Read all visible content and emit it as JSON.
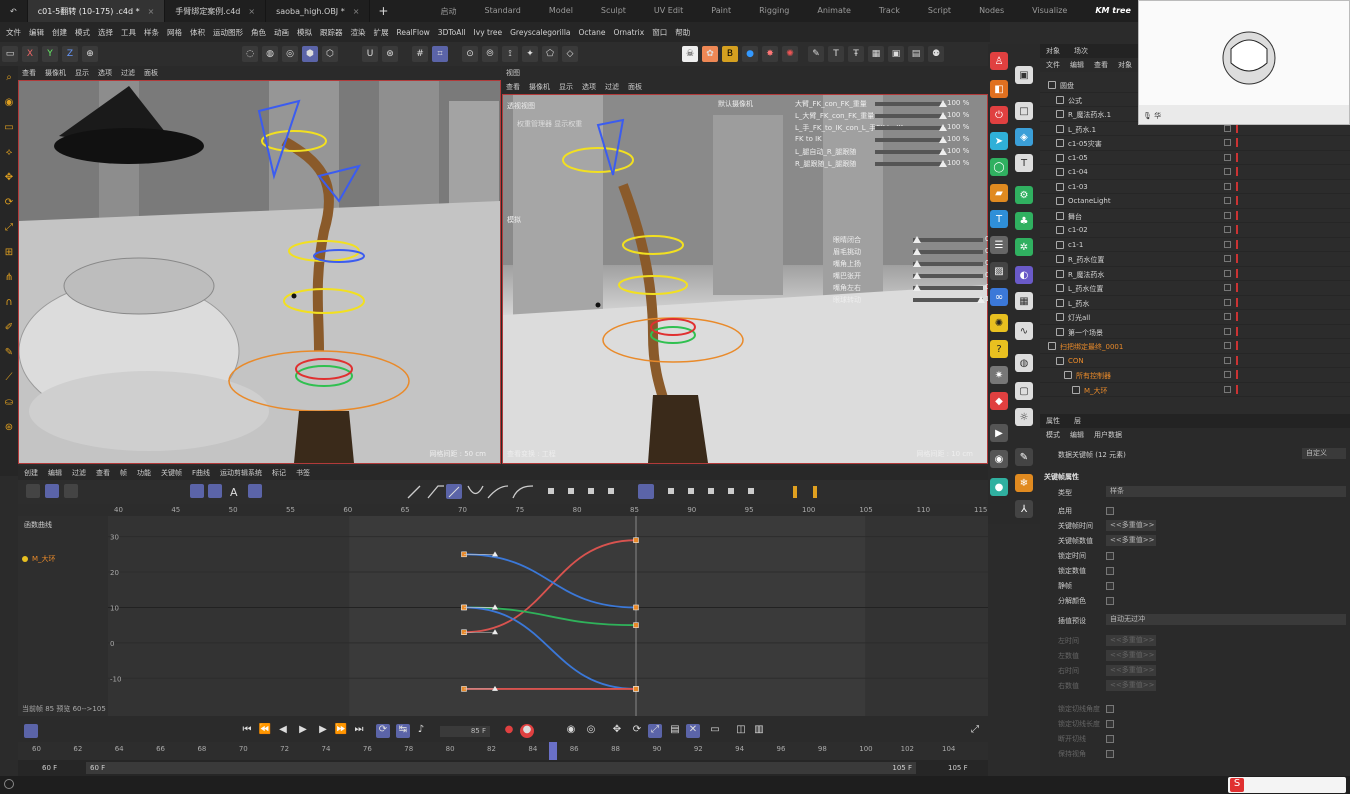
{
  "doc_tabs": [
    {
      "label": "c01-5翻转 (10-175) .c4d *",
      "active": true
    },
    {
      "label": "手臂绑定案例.c4d",
      "active": false
    },
    {
      "label": "saoba_high.OBJ *",
      "active": false
    }
  ],
  "layouts": [
    "启动",
    "Standard",
    "Model",
    "Sculpt",
    "UV Edit",
    "Paint",
    "Rigging",
    "Animate",
    "Track",
    "Script",
    "Nodes",
    "Visualize",
    "KM tree"
  ],
  "active_layout": "KM tree",
  "menu": [
    "文件",
    "编辑",
    "创建",
    "模式",
    "选择",
    "工具",
    "样条",
    "网格",
    "体积",
    "运动图形",
    "角色",
    "动画",
    "模拟",
    "跟踪器",
    "渲染",
    "扩展",
    "RealFlow",
    "3DToAll",
    "Ivy tree",
    "Greyscalegorilla",
    "Octane",
    "Ornatrix",
    "窗口",
    "帮助"
  ],
  "toolbar_xyz": [
    "X",
    "Y",
    "Z"
  ],
  "viewport_left": {
    "menu": [
      "查看",
      "摄像机",
      "显示",
      "选项",
      "过滤",
      "面板"
    ],
    "grid_label": "网格间距 : 50 cm"
  },
  "viewport_right": {
    "header": "视图",
    "menu": [
      "查看",
      "摄像机",
      "显示",
      "选项",
      "过滤",
      "面板"
    ],
    "title": "透视视图",
    "camera": "默认摄像机",
    "sub_label": "权重管理器  显示权重",
    "status": "查看变换  : 工程",
    "grid_label": "网格间距 : 10 cm",
    "sliders_top": [
      {
        "label": "大臂_FK_con_FK_重量",
        "value": "100 %"
      },
      {
        "label": "L_大臂_FK_con_FK_重量",
        "value": "100 %"
      },
      {
        "label": "L_手_FK_to_IK_con_L_手FK to IK",
        "value": "100 %"
      },
      {
        "label": "FK to IK",
        "value": "100 %"
      },
      {
        "label": "L_腿自动_R_腿跟随",
        "value": "100 %"
      },
      {
        "label": "R_腿跟随_L_腿跟随",
        "value": "100 %"
      }
    ],
    "sliders_mid": [
      {
        "label": "眼睛闭合",
        "value": "0 %"
      },
      {
        "label": "眉毛挑动",
        "value": "0 %"
      },
      {
        "label": "嘴角上扬",
        "value": "0 %"
      },
      {
        "label": "嘴巴张开",
        "value": "0 %"
      },
      {
        "label": "嘴角左右",
        "value": "0 %"
      },
      {
        "label": "眼球转动",
        "value": "100 %"
      }
    ],
    "side_label": "模拟"
  },
  "object_panel": {
    "tabs": [
      "对象",
      "场次"
    ],
    "menu": [
      "文件",
      "编辑",
      "查看",
      "对象",
      "标签",
      "书签"
    ],
    "rows": [
      {
        "name": "圆盘",
        "indent": 0,
        "color": "normal"
      },
      {
        "name": "公式",
        "indent": 1,
        "color": "normal"
      },
      {
        "name": "R_魔法药水.1",
        "indent": 1,
        "color": "normal"
      },
      {
        "name": "L_药水.1",
        "indent": 1,
        "color": "normal"
      },
      {
        "name": "c1-05灾害",
        "indent": 1,
        "color": "normal"
      },
      {
        "name": "c1-05",
        "indent": 1,
        "color": "normal"
      },
      {
        "name": "c1-04",
        "indent": 1,
        "color": "normal"
      },
      {
        "name": "c1-03",
        "indent": 1,
        "color": "normal"
      },
      {
        "name": "OctaneLight",
        "indent": 1,
        "color": "normal"
      },
      {
        "name": "舞台",
        "indent": 1,
        "color": "normal"
      },
      {
        "name": "c1-02",
        "indent": 1,
        "color": "normal"
      },
      {
        "name": "c1-1",
        "indent": 1,
        "color": "normal"
      },
      {
        "name": "R_药水位置",
        "indent": 1,
        "color": "normal"
      },
      {
        "name": "R_魔法药水",
        "indent": 1,
        "color": "normal"
      },
      {
        "name": "L_药水位置",
        "indent": 1,
        "color": "normal"
      },
      {
        "name": "L_药水",
        "indent": 1,
        "color": "normal"
      },
      {
        "name": "灯光all",
        "indent": 1,
        "color": "normal"
      },
      {
        "name": "第一个场景",
        "indent": 1,
        "color": "normal"
      },
      {
        "name": "扫把绑定最终_0001",
        "indent": 0,
        "color": "orange"
      },
      {
        "name": "CON",
        "indent": 1,
        "color": "orange"
      },
      {
        "name": "所有控制器",
        "indent": 2,
        "color": "orange"
      },
      {
        "name": "M_大环",
        "indent": 3,
        "color": "orange"
      }
    ]
  },
  "attributes": {
    "tabs": [
      "属性",
      "层"
    ],
    "menu": [
      "模式",
      "编辑",
      "用户数据"
    ],
    "heading": "数据关键帧 (12 元素)",
    "mode_value": "自定义",
    "section": "关键帧属性",
    "type_label": "类型",
    "type_value": "样条",
    "rows": [
      {
        "label": "启用",
        "kind": "checkbox",
        "dim": false
      },
      {
        "label": "关键帧时间",
        "kind": "field",
        "value": "<<多重值>>",
        "dim": false
      },
      {
        "label": "关键帧数值",
        "kind": "field",
        "value": "<<多重值>>",
        "dim": false
      },
      {
        "label": "锁定时间",
        "kind": "checkbox",
        "dim": false
      },
      {
        "label": "锁定数值",
        "kind": "checkbox",
        "dim": false
      },
      {
        "label": "静帧",
        "kind": "checkbox",
        "dim": false
      },
      {
        "label": "分解颜色",
        "kind": "checkbox",
        "dim": false
      }
    ],
    "interp_label": "插值预设",
    "interp_value": "自动无过冲",
    "dim_rows": [
      {
        "label": "左时间",
        "value": "<<多重值>>"
      },
      {
        "label": "左数值",
        "value": "<<多重值>>"
      },
      {
        "label": "右时间",
        "value": "<<多重值>>"
      },
      {
        "label": "右数值",
        "value": "<<多重值>>"
      }
    ],
    "dim_checks": [
      "锁定切线角度",
      "锁定切线长度",
      "断开切线",
      "保持视角"
    ]
  },
  "timeline": {
    "menu": [
      "创建",
      "编辑",
      "过滤",
      "查看",
      "帧",
      "功能",
      "关键帧",
      "F曲线",
      "运动剪辑系统",
      "标记",
      "书签"
    ],
    "track_header": "函数曲线",
    "track_name": "M_大环",
    "ruler": [
      40,
      45,
      50,
      55,
      60,
      65,
      70,
      75,
      80,
      85,
      90,
      95,
      100,
      105,
      110,
      115
    ],
    "y_labels": [
      30,
      20,
      10,
      0,
      -10
    ],
    "status_text": "当前帧 85  预览 60-->105",
    "frame_field": "85 F",
    "frame_ruler": [
      60,
      62,
      64,
      66,
      68,
      70,
      72,
      74,
      76,
      78,
      80,
      82,
      84,
      86,
      88,
      90,
      92,
      94,
      96,
      98,
      100,
      102,
      104
    ],
    "range_start": "60 F",
    "range_start2": "60 F",
    "range_end": "105 F",
    "range_end2": "105 F"
  },
  "chart_data": {
    "type": "line",
    "x_range": [
      40,
      115
    ],
    "y_range": [
      -15,
      33
    ],
    "current_frame": 85,
    "series": [
      {
        "color": "#d9534f",
        "points": [
          [
            70,
            3
          ],
          [
            85,
            29
          ]
        ]
      },
      {
        "color": "#3b78d8",
        "points": [
          [
            70,
            25
          ],
          [
            85,
            10
          ]
        ]
      },
      {
        "color": "#2fb25a",
        "points": [
          [
            70,
            10
          ],
          [
            85,
            5
          ]
        ]
      },
      {
        "color": "#3b78d8",
        "points": [
          [
            70,
            10
          ],
          [
            85,
            -13
          ]
        ]
      },
      {
        "color": "#d9534f",
        "points": [
          [
            70,
            -13
          ],
          [
            85,
            -13
          ]
        ]
      }
    ]
  },
  "webcam_mic": "华",
  "colors": {
    "accent": "#5b64a8",
    "key_orange": "#e98a2a",
    "border_red": "#b23a3a"
  }
}
